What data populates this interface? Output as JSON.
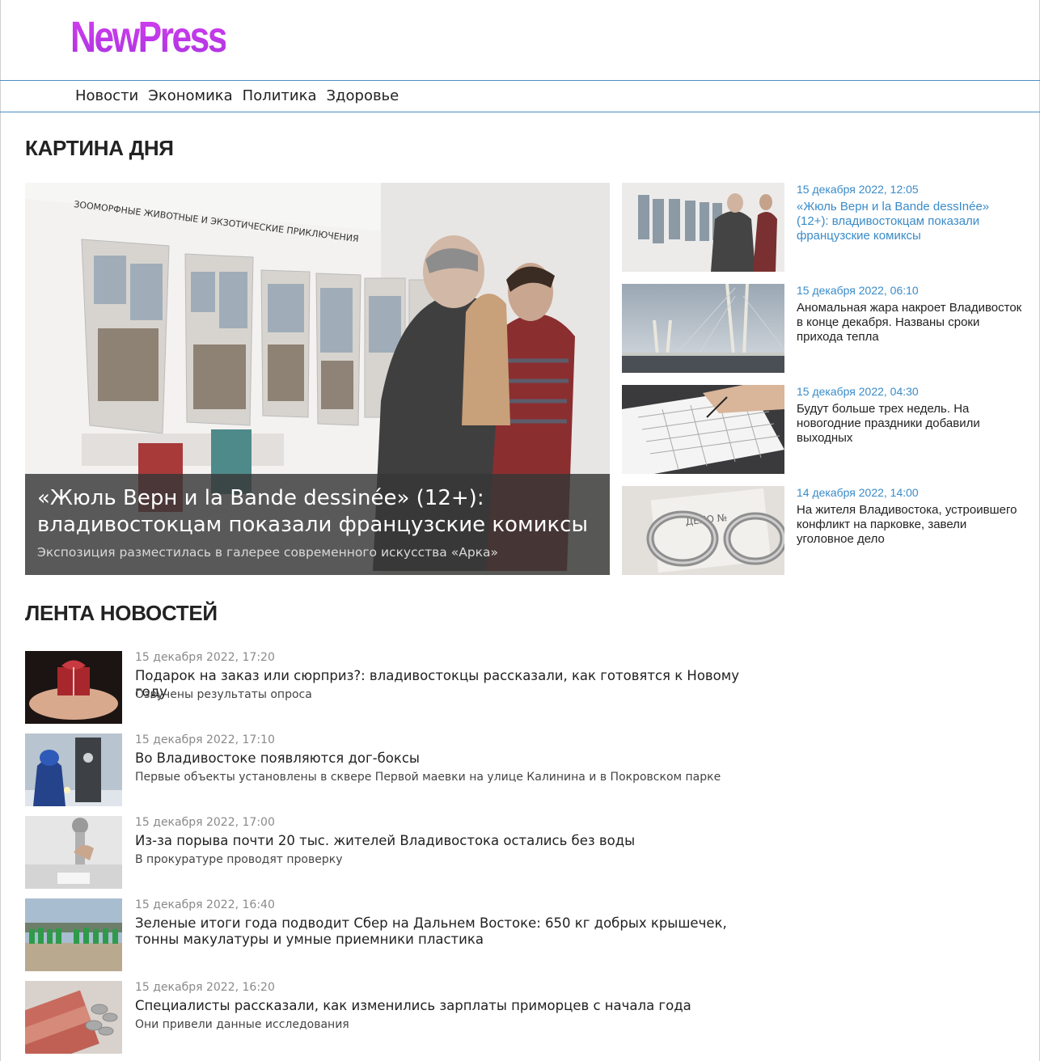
{
  "brand": {
    "logo": "NewPress",
    "accent_color": "#c53de8",
    "link_color": "#3a8bc8"
  },
  "nav": {
    "items": [
      "Новости",
      "Экономика",
      "Политика",
      "Здоровье"
    ]
  },
  "sections": {
    "day_picture": "КАРТИНА ДНЯ",
    "news_feed": "ЛЕНТА НОВОСТЕЙ"
  },
  "hero": {
    "title": "«Жюль Верн и la Bande dessinée» (12+): владивостокцам показали французские комиксы",
    "subtitle": "Экспозиция разместилась в галерее современного искусства «Арка»"
  },
  "side_news": [
    {
      "date": "15 декабря 2022, 12:05",
      "title": "«Жюль Верн и la Bande dessInée» (12+): владивостокцам показали французские комиксы"
    },
    {
      "date": "15 декабря 2022, 06:10",
      "title": "Аномальная жара накроет Владивосток в конце декабря. Названы сроки прихода тепла"
    },
    {
      "date": "15 декабря 2022, 04:30",
      "title": "Будут больше трех недель. На новогодние праздники добавили выходных"
    },
    {
      "date": "14 декабря 2022, 14:00",
      "title": "На жителя Владивостока, устроившего конфликт на парковке, завели уголовное дело"
    }
  ],
  "feed": [
    {
      "date": "15 декабря 2022, 17:20",
      "title": "Подарок на заказ или сюрприз?: владивостокцы рассказали, как готовятся к Новому году",
      "subtitle": "Озвучены результаты опроса"
    },
    {
      "date": "15 декабря 2022, 17:10",
      "title": "Во Владивостоке появляются дог-боксы",
      "subtitle": "Первые объекты установлены в сквере Первой маевки на улице Калинина и в Покровском парке"
    },
    {
      "date": "15 декабря 2022, 17:00",
      "title": "Из-за порыва почти 20 тыс. жителей Владивостока остались без воды",
      "subtitle": "В прокуратуре проводят проверку"
    },
    {
      "date": "15 декабря 2022, 16:40",
      "title": "Зеленые итоги года подводит Сбер на Дальнем Востоке: 650 кг добрых крышечек, тонны макулатуры и умные приемники пластика",
      "subtitle": ""
    },
    {
      "date": "15 декабря 2022, 16:20",
      "title": "Специалисты рассказали, как изменились зарплаты приморцев с начала года",
      "subtitle": "Они привели данные исследования"
    }
  ]
}
